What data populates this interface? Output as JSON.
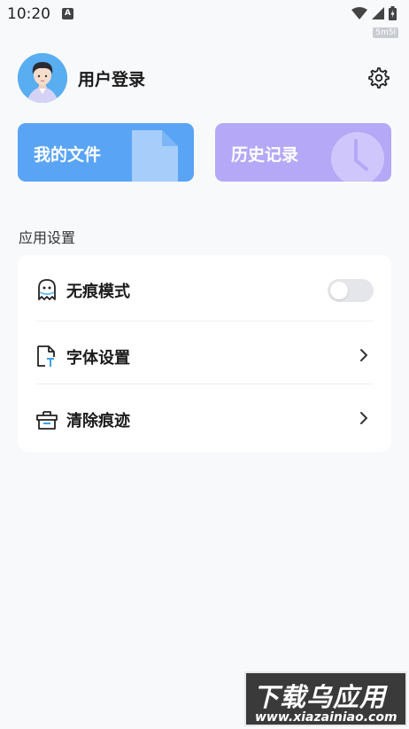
{
  "status_bar": {
    "time": "10:20",
    "notification_icon": "A",
    "speed_badge": "5m5l"
  },
  "profile": {
    "login_label": "用户登录",
    "settings_icon": "gear-icon"
  },
  "cards": {
    "files_label": "我的文件",
    "history_label": "历史记录",
    "files_color": "#5aa4f5",
    "history_color": "#b4a8f7"
  },
  "settings": {
    "section_title": "应用设置",
    "items": [
      {
        "label": "无痕模式",
        "icon": "ghost-icon",
        "control": "toggle",
        "enabled": false
      },
      {
        "label": "字体设置",
        "icon": "font-file-icon",
        "control": "chevron"
      },
      {
        "label": "清除痕迹",
        "icon": "cleanup-icon",
        "control": "chevron"
      }
    ]
  },
  "watermark": {
    "title": "下载乌应用",
    "url": "www.xiazainiao.com"
  }
}
